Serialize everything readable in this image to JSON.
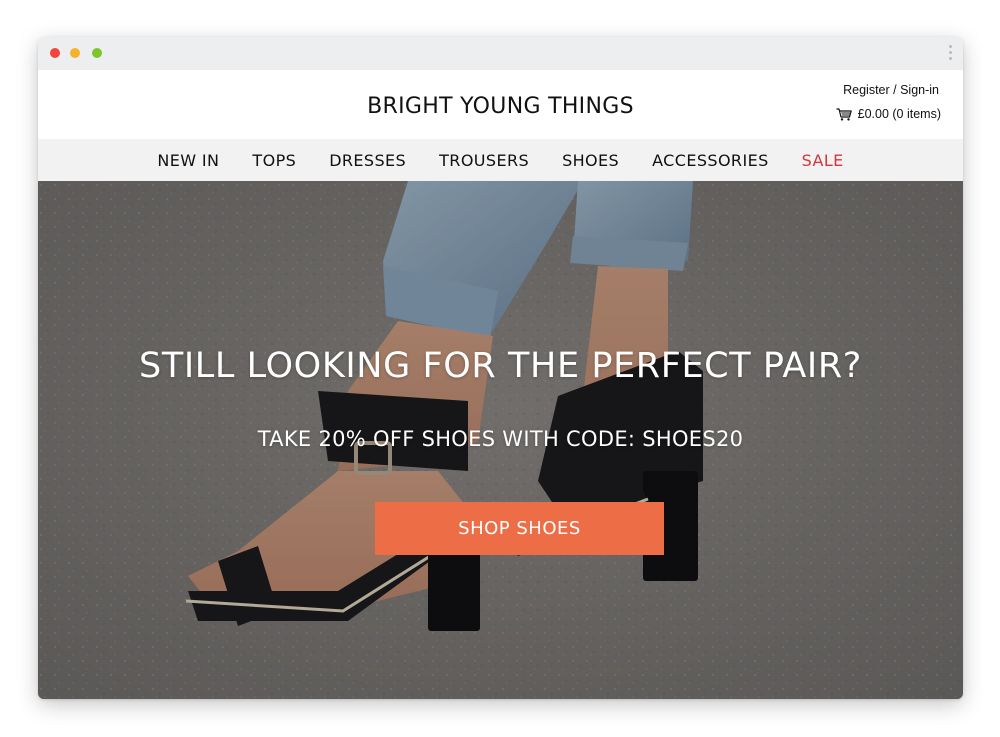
{
  "browser": {
    "buttons": [
      "close",
      "minimize",
      "maximize"
    ],
    "menu_icon": "kebab-menu-icon"
  },
  "header": {
    "brand": "BRIGHT YOUNG THINGS",
    "account_link": "Register / Sign-in",
    "cart_text": "£0.00 (0 items)",
    "cart_icon": "cart-icon"
  },
  "nav": {
    "items": [
      {
        "label": "NEW IN"
      },
      {
        "label": "TOPS"
      },
      {
        "label": "DRESSES"
      },
      {
        "label": "TROUSERS"
      },
      {
        "label": "SHOES"
      },
      {
        "label": "ACCESSORIES"
      },
      {
        "label": "SALE"
      }
    ]
  },
  "hero": {
    "title": "STILL LOOKING FOR THE PERFECT PAIR?",
    "subtitle": "TAKE 20% OFF SHOES WITH CODE: SHOES20",
    "cta_label": "SHOP SHOES"
  },
  "colors": {
    "sale": "#d3363a",
    "cta": "#ec6d46",
    "nav_bg": "#f2f2f2"
  }
}
